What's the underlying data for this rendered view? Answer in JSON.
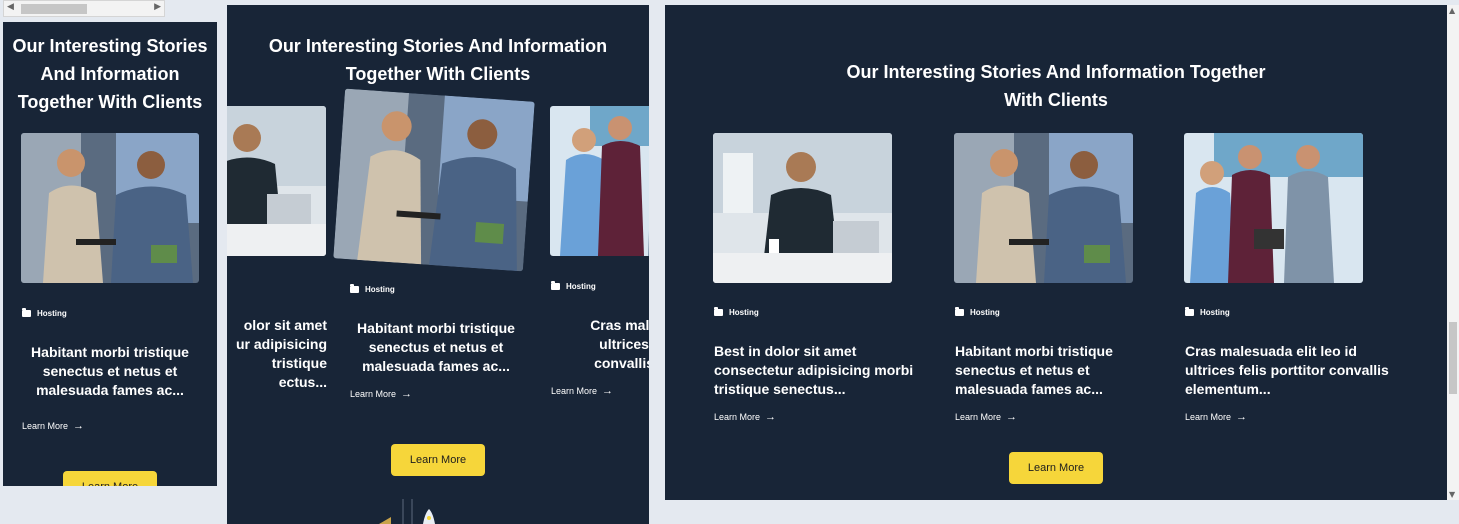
{
  "section": {
    "title": "Our Interesting Stories And Information Together With Clients",
    "title_lines_narrow": [
      "Our Interesting Stories",
      "And Information",
      "Together With Clients"
    ],
    "title_lines_medium": [
      "Our Interesting Stories And Information",
      "Together With Clients"
    ],
    "title_lines_wide": [
      "Our Interesting Stories And Information Together",
      "With Clients"
    ]
  },
  "cards": [
    {
      "category": "Hosting",
      "title": "Best in dolor sit amet consectetur adipisicing morbi tristique senectus...",
      "lines": [
        "Best in dolor sit amet",
        "consectetur adipisicing morbi",
        "tristique senectus..."
      ],
      "lines_cut": [
        "olor sit amet",
        "ur adipisicing",
        "tristique",
        "ectus..."
      ],
      "learn_more": "Learn More",
      "image": "businessman-at-desk-photo"
    },
    {
      "category": "Hosting",
      "title": "Habitant morbi tristique senectus et netus et malesuada fames ac...",
      "lines": [
        "Habitant morbi tristique",
        "senectus et netus et",
        "malesuada fames ac..."
      ],
      "learn_more": "Learn More",
      "image": "two-colleagues-with-tablet-photo"
    },
    {
      "category": "Hosting",
      "title": "Cras malesuada elit leo id ultrices felis porttitor convallis elementum...",
      "lines": [
        "Cras malesuada elit leo id",
        "ultrices felis porttitor convallis",
        "elementum..."
      ],
      "lines_cut": [
        "Cras malesuad",
        "ultrices felis",
        "convallis elen"
      ],
      "learn_more": "Learn More",
      "image": "team-discussion-photo"
    }
  ],
  "button": {
    "label": "Learn More"
  },
  "colors": {
    "background": "#182537",
    "accent": "#f6d63a",
    "page": "#e4e9f0"
  }
}
